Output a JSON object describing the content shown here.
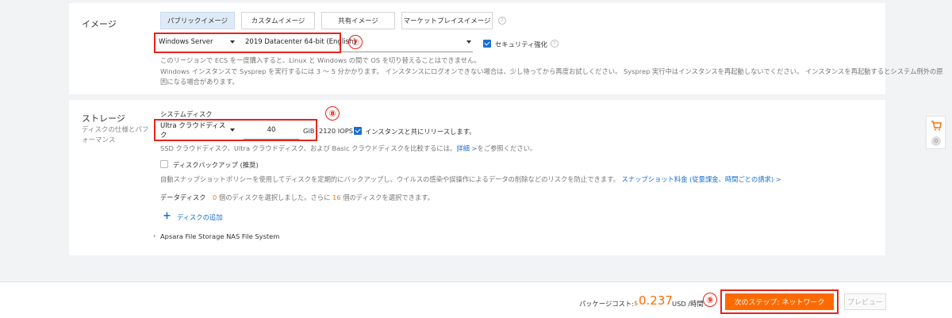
{
  "image": {
    "title": "イメージ",
    "tabs": [
      {
        "label": "パブリックイメージ",
        "active": true
      },
      {
        "label": "カスタムイメージ",
        "active": false
      },
      {
        "label": "共有イメージ",
        "active": false
      },
      {
        "label": "マーケットプレイスイメージ",
        "active": false
      }
    ],
    "os_select": "Windows Server",
    "version_select": "2019 Datacenter 64-bit (English)",
    "security_label": "セキュリティ強化",
    "security_checked": true,
    "step_marker": "⑦",
    "note1": "このリージョンで ECS を一度購入すると、Linux と Windows の間で OS を切り替えることはできません。",
    "note2_line1": "Windows インスタンスで Sysprep を実行するには 3 ～ 5 分かかります。 インスタンスにログオンできない場合は、少し待ってから再度お試しください。 Sysprep 実行中はインスタンスを再起動しないでください。 インスタンスを再起動するとシステム例外の原",
    "note2_line2": "因になる場合があります。"
  },
  "storage": {
    "title": "ストレージ",
    "subtitle": "ディスクの仕様とパフォーマンス",
    "system_disk_label": "システムディスク",
    "disk_type": "Ultra クラウドディスク",
    "disk_size": "40",
    "unit": "GiB",
    "iops": "2120 IOPS",
    "release_label": "インスタンスと共にリリースします。",
    "release_checked": true,
    "step_marker": "⑧",
    "compare_note": "SSD クラウドディスク、Ultra クラウドディスク、および Basic クラウドディスクを比較するには、",
    "compare_link": "詳細 >",
    "compare_suffix": "をご参照ください。",
    "backup_label": "ディスクバックアップ (推奨)",
    "backup_note": "自動スナップショットポリシーを使用してディスクを定期的にバックアップし、ウイルスの感染や誤操作によるデータの削除などのリスクを防止できます。",
    "backup_link": "スナップショット料金 (従量課金、時間ごとの請求) >",
    "data_disk_label": "データディスク",
    "data_disk_count": "0",
    "data_disk_text1": "個のディスクを選択しました。さらに",
    "data_disk_remaining": "16",
    "data_disk_text2": "個のディスクを選択できます。",
    "add_disk_label": "ディスクの追加",
    "nas_label": "Apsara File Storage NAS File System"
  },
  "cart": {
    "count": "0"
  },
  "footer": {
    "cost_label": "パッケージコスト:",
    "currency": "$",
    "price": "0.237",
    "price_unit": "USD /時間",
    "step_marker": "⑨",
    "next_button": "次のステップ: ネットワーク",
    "preview_button": "プレビュー"
  },
  "colors": {
    "accent": "#ff6a00",
    "link": "#1a6fd1",
    "highlight_box": "#e8231a"
  }
}
